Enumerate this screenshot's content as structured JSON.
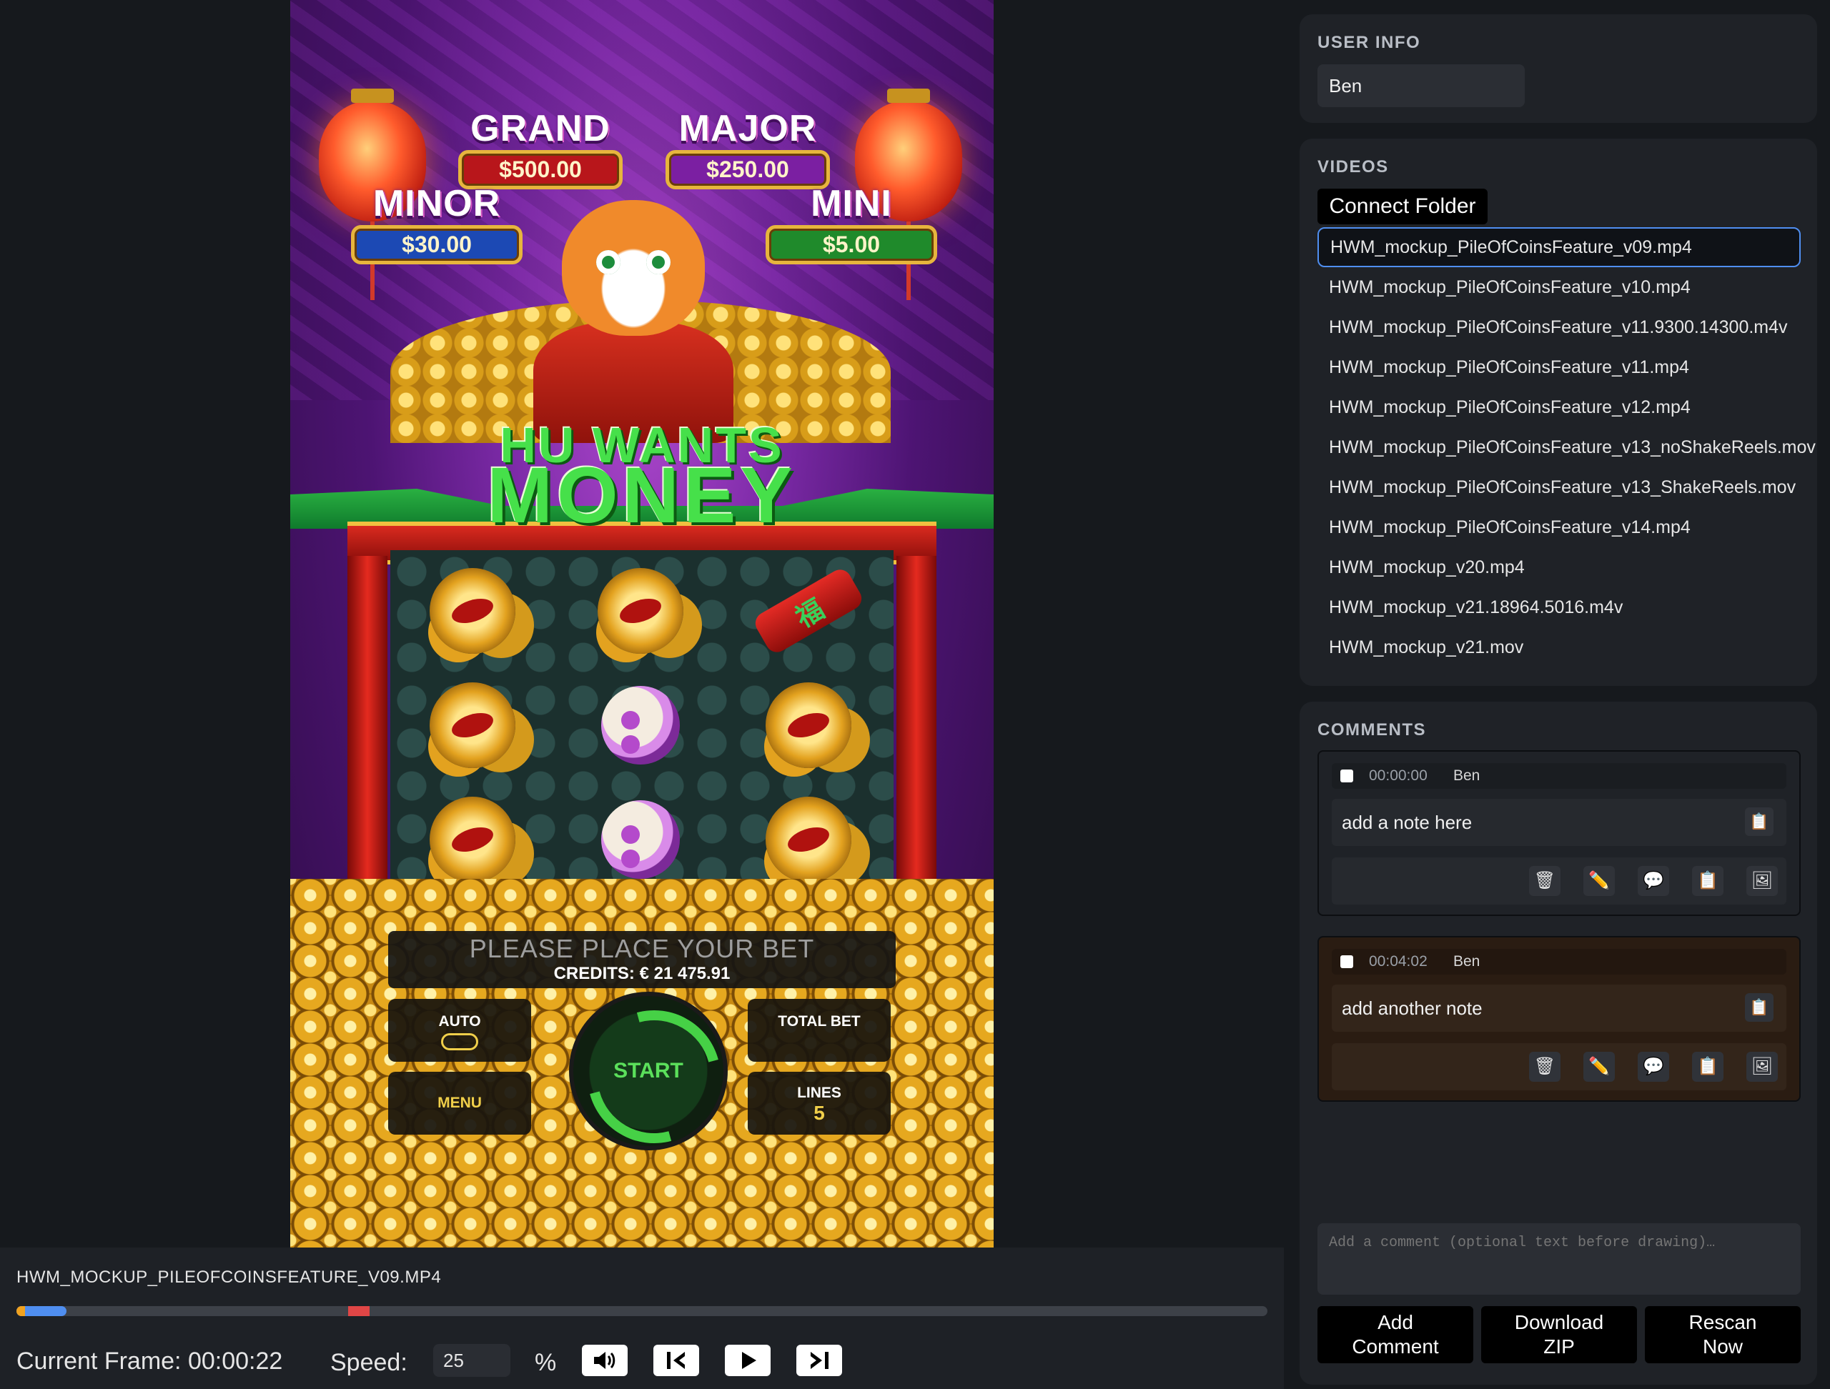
{
  "game": {
    "jackpots": [
      {
        "name": "GRAND",
        "amount": "$500.00",
        "color": "#b8161b"
      },
      {
        "name": "MAJOR",
        "amount": "$250.00",
        "color": "#7b1fa2"
      },
      {
        "name": "MINOR",
        "amount": "$30.00",
        "color": "#1c49b4"
      },
      {
        "name": "MINI",
        "amount": "$5.00",
        "color": "#1f8a2b"
      }
    ],
    "logo_line1": "HU WANTS",
    "logo_line2": "MONEY",
    "rocket_glyph": "福",
    "bet_message": "PLEASE PLACE YOUR BET",
    "credits": "CREDITS: € 21 475.91",
    "auto_label": "AUTO",
    "menu_label": "MENU",
    "start_label": "START",
    "total_bet_label": "TOTAL BET",
    "lines_label": "LINES",
    "lines_value": "5"
  },
  "player": {
    "filename": "HWM_MOCKUP_PILEOFCOINSFEATURE_V09.MP4",
    "progress": 0.04,
    "current_frame_label": "Current Frame: 00:00:22",
    "speed_label": "Speed:",
    "speed_value": "25",
    "percent_symbol": "%",
    "controls": [
      "volume-icon",
      "skip-back-icon",
      "play-icon",
      "skip-forward-icon"
    ]
  },
  "sidebar": {
    "user_info": {
      "title": "USER INFO",
      "name": "Ben"
    },
    "videos": {
      "title": "VIDEOS",
      "connect_label": "Connect Folder",
      "selected_index": 0,
      "items": [
        "HWM_mockup_PileOfCoinsFeature_v09.mp4",
        "HWM_mockup_PileOfCoinsFeature_v10.mp4",
        "HWM_mockup_PileOfCoinsFeature_v11.9300.14300.m4v",
        "HWM_mockup_PileOfCoinsFeature_v11.mp4",
        "HWM_mockup_PileOfCoinsFeature_v12.mp4",
        "HWM_mockup_PileOfCoinsFeature_v13_noShakeReels.mov",
        "HWM_mockup_PileOfCoinsFeature_v13_ShakeReels.mov",
        "HWM_mockup_PileOfCoinsFeature_v14.mp4",
        "HWM_mockup_v20.mp4",
        "HWM_mockup_v21.18964.5016.m4v",
        "HWM_mockup_v21.mov"
      ]
    },
    "comments": {
      "title": "COMMENTS",
      "items": [
        {
          "time": "00:00:00",
          "user": "Ben",
          "text": "add a note here",
          "bg": "#1f2227"
        },
        {
          "time": "00:04:02",
          "user": "Ben",
          "text": "add another note",
          "bg": "#2a1c12"
        }
      ],
      "tool_icons": [
        "trash-icon",
        "pencil-icon",
        "speech-bubble-icon",
        "clipboard-icon",
        "image-icon"
      ],
      "input_placeholder": "Add a comment (optional text before drawing)…",
      "add_label": "Add Comment",
      "download_label": "Download ZIP",
      "rescan_label": "Rescan Now"
    }
  },
  "colors": {
    "accent": "#4f8ef0",
    "marker": "#e04646",
    "background": "#16191d",
    "card": "#1f2227"
  }
}
